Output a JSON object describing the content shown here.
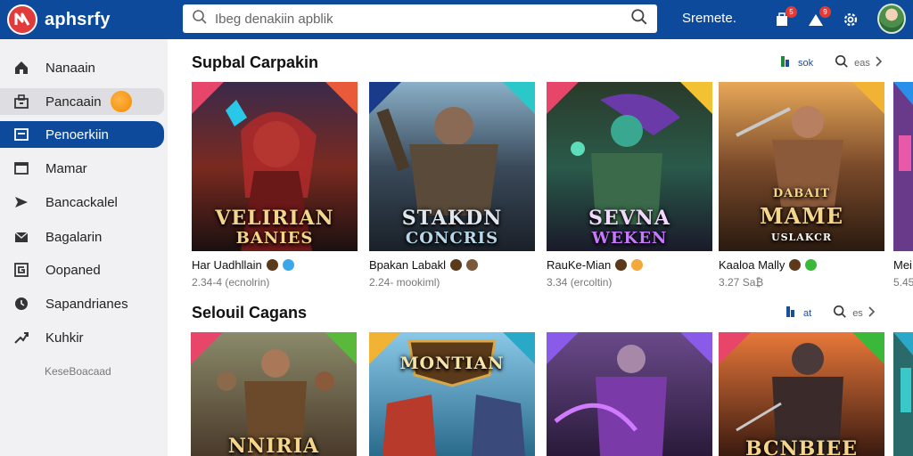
{
  "app": {
    "name": "aphsrfy"
  },
  "search": {
    "placeholder": "Ibeg denakiin apblik"
  },
  "header": {
    "link": "Sremete.",
    "cart_badge": "5",
    "notif_badge": "9"
  },
  "sidebar": {
    "items": [
      {
        "label": "Nanaain",
        "icon": "home-icon"
      },
      {
        "label": "Pancaain",
        "icon": "store-icon"
      },
      {
        "label": "Penoerkiin",
        "icon": "library-icon"
      },
      {
        "label": "Mamar",
        "icon": "window-icon"
      },
      {
        "label": "Bancackalel",
        "icon": "send-icon"
      },
      {
        "label": "Bagalarin",
        "icon": "mail-icon"
      },
      {
        "label": "Oopaned",
        "icon": "g-icon"
      },
      {
        "label": "Sapandrianes",
        "icon": "clock-icon"
      },
      {
        "label": "Kuhkir",
        "icon": "trend-icon"
      }
    ],
    "footer": "KeseBoacaad"
  },
  "sections": [
    {
      "title": "Supbal Carpakin",
      "tool_label": "sok",
      "more_label": "eas",
      "cards": [
        {
          "art_title": "VELIRIAN",
          "art_subtitle": "BANIES",
          "name": "Har Uadhllain",
          "meta": "2.34-4 (ecnolrin)",
          "accent": "#e8456a",
          "tint": "#7a2a20"
        },
        {
          "art_title": "STAKDN",
          "art_subtitle": "CONCRIS",
          "name": "Bpakan Labakl",
          "meta": "2.24- mookiml)",
          "accent": "#2aa8c8",
          "tint": "#3a4a5a"
        },
        {
          "art_title": "SEVNA",
          "art_subtitle": "WEKEN",
          "name": "RauKe-Mian",
          "meta": "3.34 (ercoltin)",
          "accent": "#e8456a",
          "tint": "#2a5a4a"
        },
        {
          "art_title": "DABAIT",
          "art_subtitle": "MAME",
          "art_extra": "USLAKCR",
          "name": "Kaaloa Mally",
          "meta": "3.27 Sa₿",
          "accent": "#f2b233",
          "tint": "#7a4a2a"
        },
        {
          "art_title": "",
          "art_subtitle": "",
          "name": "Mei",
          "meta": "5.45",
          "accent": "#2a8fe8",
          "tint": "#6a3a8a"
        }
      ]
    },
    {
      "title": "Selouil Cagans",
      "tool_label": "at",
      "more_label": "es",
      "cards": [
        {
          "art_title": "",
          "art_subtitle": "NNIRIA",
          "accent": "#e8456a",
          "tint": "#6a4a2a"
        },
        {
          "art_title": "MONTIAN",
          "art_subtitle": "",
          "accent": "#f2b233",
          "tint": "#2a6a8a"
        },
        {
          "art_title": "",
          "art_subtitle": "",
          "accent": "#8a5ae8",
          "tint": "#4a2a6a"
        },
        {
          "art_title": "",
          "art_subtitle": "BCNBIEE",
          "accent": "#e8456a",
          "tint": "#8a3a1a"
        },
        {
          "art_title": "",
          "art_subtitle": "",
          "accent": "#2aa8c8",
          "tint": "#2a6a6a"
        }
      ]
    }
  ],
  "colors": {
    "primary": "#0d4a9c",
    "sidebar_bg": "#f1f1f3"
  }
}
